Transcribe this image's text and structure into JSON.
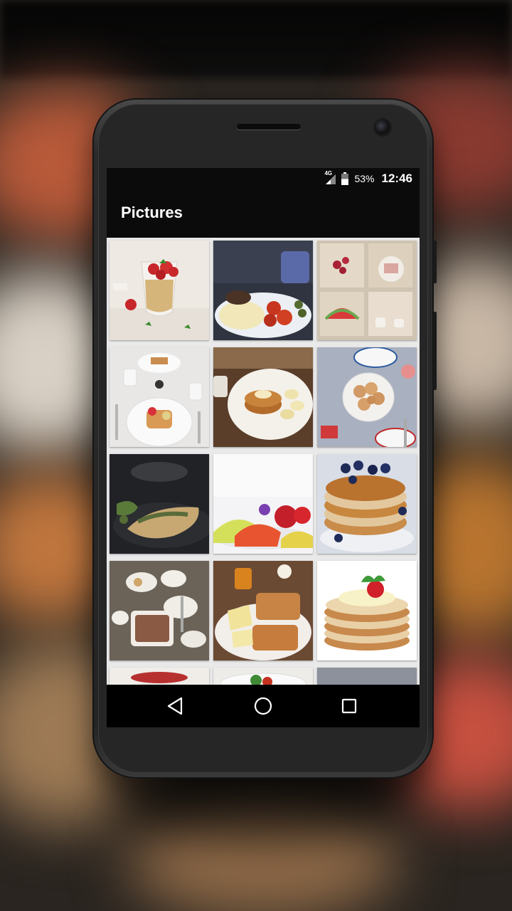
{
  "status_bar": {
    "network": "4G",
    "battery_percent": "53%",
    "time": "12:46",
    "battery_level": 0.53
  },
  "app_bar": {
    "title": "Pictures"
  },
  "gallery": {
    "items": [
      {
        "name": "photo-strawberry-parfait",
        "icon": "image"
      },
      {
        "name": "photo-omelette-breakfast",
        "icon": "image"
      },
      {
        "name": "photo-fruit-collage",
        "icon": "image"
      },
      {
        "name": "photo-french-toast-table",
        "icon": "image"
      },
      {
        "name": "photo-pancakes-bananas",
        "icon": "image"
      },
      {
        "name": "photo-pancakes-table",
        "icon": "image"
      },
      {
        "name": "photo-stuffed-crepe",
        "icon": "image"
      },
      {
        "name": "photo-fruit-plate",
        "icon": "image"
      },
      {
        "name": "photo-blueberry-pancakes",
        "icon": "image"
      },
      {
        "name": "photo-breakfast-spread",
        "icon": "image"
      },
      {
        "name": "photo-toast-cheese",
        "icon": "image"
      },
      {
        "name": "photo-strawberry-pancakes",
        "icon": "image"
      },
      {
        "name": "photo-partial-1",
        "icon": "image"
      },
      {
        "name": "photo-partial-2",
        "icon": "image"
      },
      {
        "name": "photo-partial-3",
        "icon": "image"
      }
    ]
  },
  "nav_bar": {
    "back_icon": "back-triangle",
    "home_icon": "home-circle",
    "recents_icon": "recents-square"
  }
}
